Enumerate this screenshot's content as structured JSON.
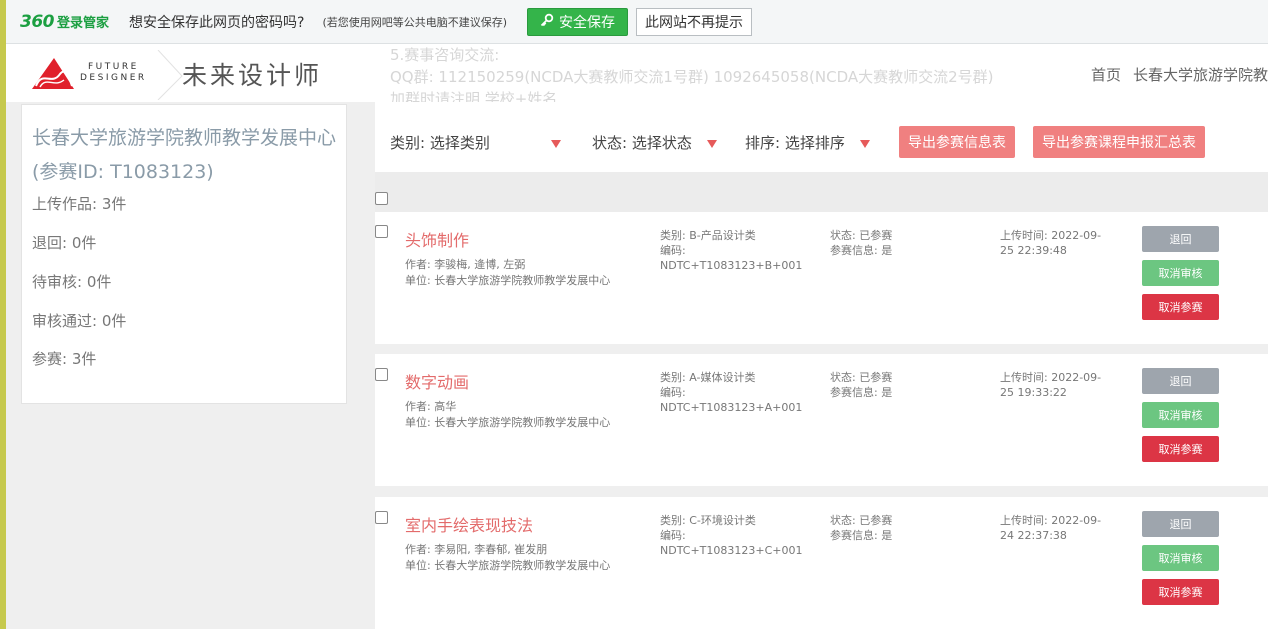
{
  "browser_bar": {
    "brand_number": "360",
    "brand_text": "登录管家",
    "question": "想安全保存此网页的密码吗?",
    "note": "(若您使用网吧等公共电脑不建议保存)",
    "save_label": "安全保存",
    "never_label": "此网站不再提示"
  },
  "header": {
    "logo_line1": "FUTURE",
    "logo_line2": "DESIGNER",
    "site_title": "未来设计师",
    "notice": [
      "5.赛事咨询交流:",
      "QQ群: 112150259(NCDA大赛教师交流1号群) 1092645058(NCDA大赛教师交流2号群)",
      "加群时请注明 学校+姓名"
    ],
    "nav": [
      "首页",
      "长春大学旅游学院教"
    ]
  },
  "sidebar": {
    "unit_name": "长春大学旅游学院教师教学发展中心",
    "participant_id": "(参赛ID: T1083123)",
    "stats": [
      "上传作品: 3件",
      "退回: 0件",
      "待审核: 0件",
      "审核通过: 0件",
      "参赛: 3件"
    ]
  },
  "filters": {
    "category_label": "类别:",
    "category_value": "选择类别",
    "status_label": "状态:",
    "status_value": "选择状态",
    "sort_label": "排序:",
    "sort_value": "选择排序",
    "export_info": "导出参赛信息表",
    "export_summary": "导出参赛课程申报汇总表"
  },
  "works": [
    {
      "title": "头饰制作",
      "author": "作者: 李骏梅, 逄博, 左弼",
      "unit": "单位: 长春大学旅游学院教师教学发展中心",
      "category": "类别: B-产品设计类",
      "code_label": "编码:",
      "code": "NDTC+T1083123+B+001",
      "status": "状态: 已参赛",
      "info": "参赛信息: 是",
      "upload_line1": "上传时间: 2022-09-",
      "upload_line2": "25 22:39:48",
      "btn_return": "退回",
      "btn_cancel_review": "取消审核",
      "btn_cancel_entry": "取消参赛"
    },
    {
      "title": "数字动画",
      "author": "作者: 高华",
      "unit": "单位: 长春大学旅游学院教师教学发展中心",
      "category": "类别: A-媒体设计类",
      "code_label": "编码:",
      "code": "NDTC+T1083123+A+001",
      "status": "状态: 已参赛",
      "info": "参赛信息: 是",
      "upload_line1": "上传时间: 2022-09-",
      "upload_line2": "25 19:33:22",
      "btn_return": "退回",
      "btn_cancel_review": "取消审核",
      "btn_cancel_entry": "取消参赛"
    },
    {
      "title": "室内手绘表现技法",
      "author": "作者: 李易阳, 李春郁, 崔发朋",
      "unit": "单位: 长春大学旅游学院教师教学发展中心",
      "category": "类别: C-环境设计类",
      "code_label": "编码:",
      "code": "NDTC+T1083123+C+001",
      "status": "状态: 已参赛",
      "info": "参赛信息: 是",
      "upload_line1": "上传时间: 2022-09-",
      "upload_line2": "24 22:37:38",
      "btn_return": "退回",
      "btn_cancel_review": "取消审核",
      "btn_cancel_entry": "取消参赛"
    }
  ],
  "colors": {
    "accent_red": "#e36b6b",
    "brand_green": "#1b9f41",
    "save_green": "#34b44a",
    "approve_green": "#6cc681",
    "danger_red": "#dc3545"
  }
}
